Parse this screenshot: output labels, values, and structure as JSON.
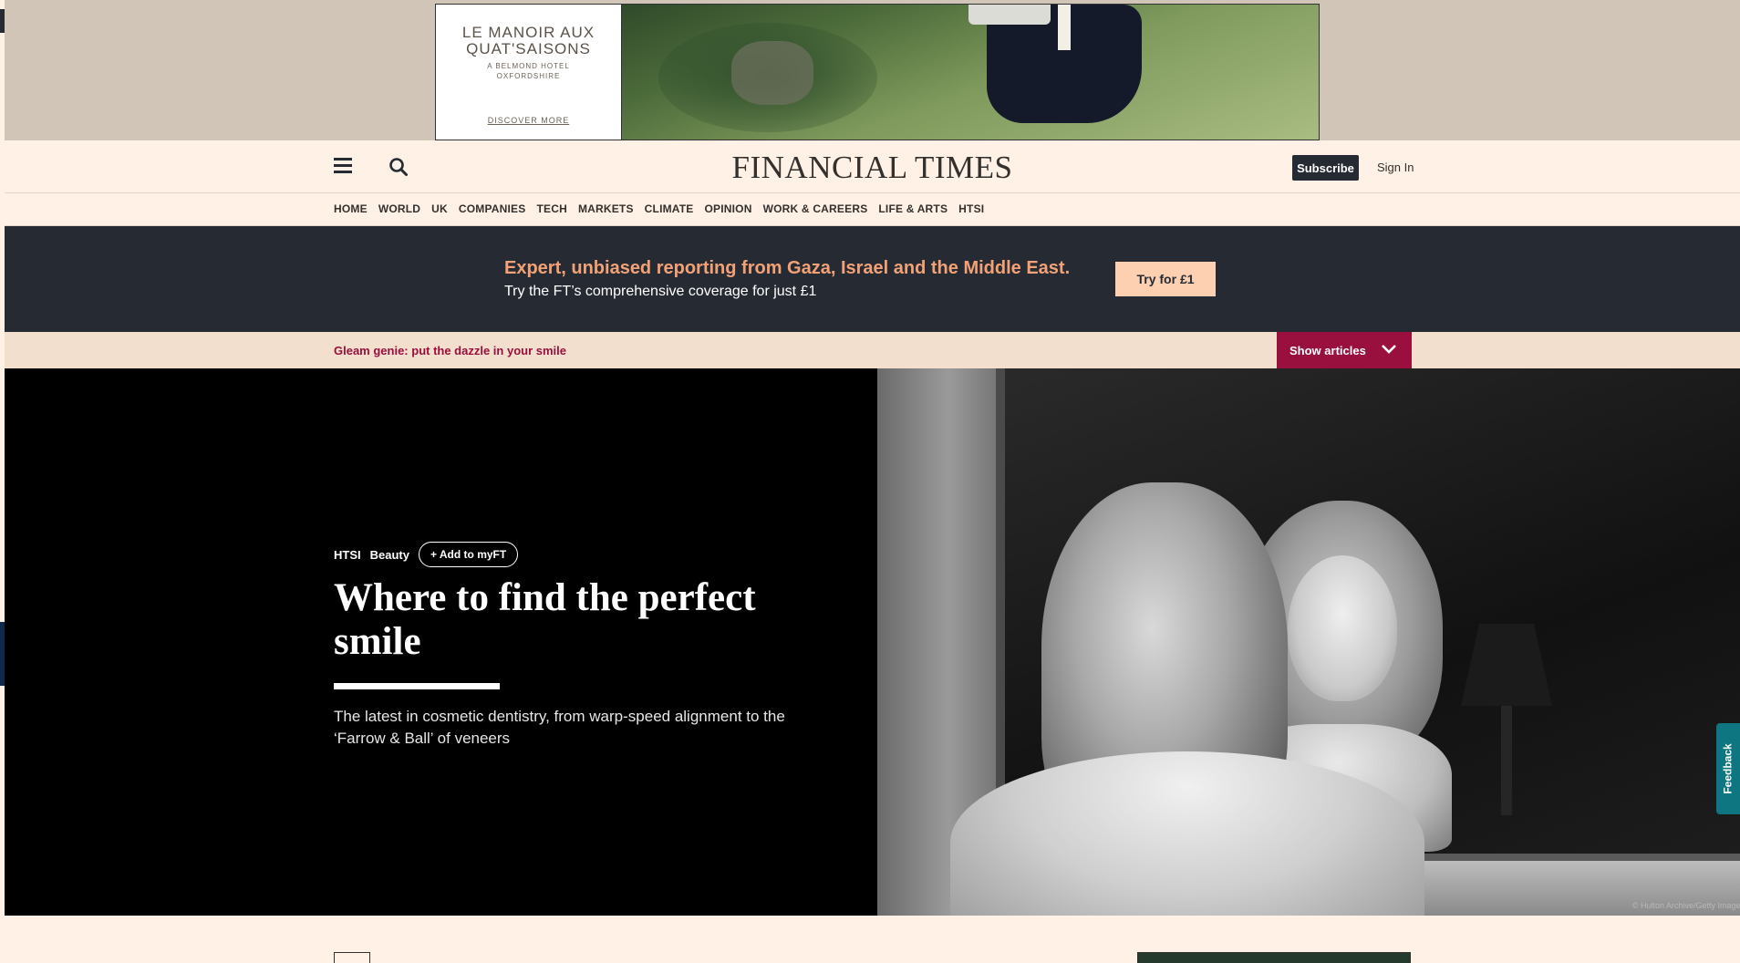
{
  "ad": {
    "brand": "LE MANOIR AUX QUAT'SAISONS",
    "subtitle": "A BELMOND HOTEL OXFORDSHIRE",
    "cta": "DISCOVER MORE"
  },
  "header": {
    "masthead": "FINANCIAL TIMES",
    "subscribe_label": "Subscribe",
    "signin_label": "Sign In",
    "icons": {
      "menu": "hamburger-icon",
      "search": "search-icon"
    }
  },
  "nav": {
    "items": [
      "HOME",
      "WORLD",
      "UK",
      "COMPANIES",
      "TECH",
      "MARKETS",
      "CLIMATE",
      "OPINION",
      "WORK & CAREERS",
      "LIFE & ARTS",
      "HTSI"
    ]
  },
  "promo": {
    "title": "Expert, unbiased reporting from Gaza, Israel and the Middle East.",
    "subtitle": "Try the FT’s comprehensive coverage for just £1",
    "button": "Try for £1"
  },
  "series": {
    "title": "Gleam genie: put the dazzle in your smile",
    "show_articles": "Show articles"
  },
  "hero": {
    "tags": [
      "HTSI",
      "Beauty"
    ],
    "add_to_myft": "+ Add to myFT",
    "title": "Where to find the perfect smile",
    "standfirst": "The latest in cosmetic dentistry, from warp-speed alignment to the ‘Farrow & Ball’ of veneers",
    "credit": "© Hulton Archive/Getty Images"
  },
  "feedback": "Feedback",
  "colors": {
    "paper": "#fff1e5",
    "slate": "#262a33",
    "claret": "#990f3d",
    "promo_accent": "#f2a276",
    "teal": "#0d7680"
  }
}
